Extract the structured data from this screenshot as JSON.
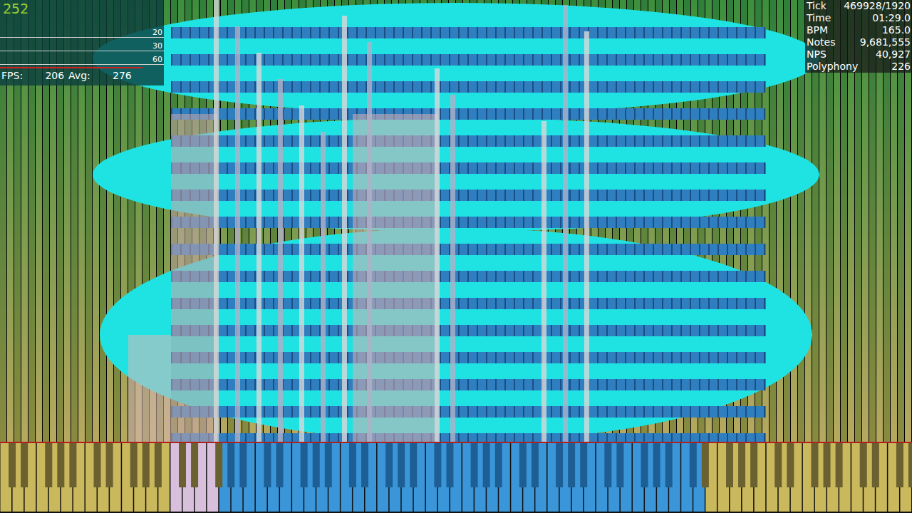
{
  "fps_overlay": {
    "frame_count": "252",
    "graph_labels": [
      "20",
      "30",
      "60"
    ],
    "fps_label": "FPS:",
    "fps_value": "206",
    "avg_label": "Avg:",
    "avg_value": "276"
  },
  "stats": [
    {
      "label": "Tick",
      "value": "469928/1920"
    },
    {
      "label": "Time",
      "value": "01:29.0"
    },
    {
      "label": "BPM",
      "value": "165.0"
    },
    {
      "label": "Notes",
      "value": "9,681,555"
    },
    {
      "label": "NPS",
      "value": "40,927"
    },
    {
      "label": "Polyphony",
      "value": "226"
    }
  ]
}
